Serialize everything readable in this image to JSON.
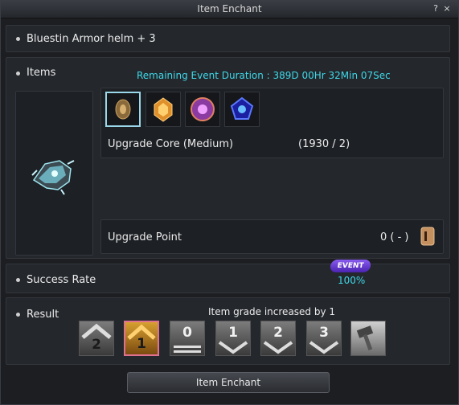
{
  "window": {
    "title": "Item Enchant",
    "help_label": "?",
    "close_label": "×"
  },
  "item": {
    "name": "Bluestin Armor helm + 3"
  },
  "items_section": {
    "label": "Items",
    "event_duration": "Remaining Event Duration : 389D 00Hr 32Min 07Sec",
    "materials": [
      {
        "icon": "brown-core-icon"
      },
      {
        "icon": "orange-crystal-icon"
      },
      {
        "icon": "purple-orb-icon"
      },
      {
        "icon": "blue-pentagon-icon"
      }
    ],
    "upgrade_core_label": "Upgrade Core (Medium)",
    "upgrade_core_count": "(1930 / 2)",
    "upgrade_point_label": "Upgrade Point",
    "upgrade_point_value": "0 ( - )"
  },
  "success": {
    "label": "Success Rate",
    "event_badge": "EVENT",
    "rate": "100%"
  },
  "result": {
    "label": "Result",
    "message": "Item grade increased by 1",
    "grades": [
      "2",
      "1",
      "0",
      "1",
      "2",
      "3"
    ]
  },
  "actions": {
    "enchant_label": "Item Enchant"
  },
  "colors": {
    "accent": "#3fd8e8",
    "selected": "#9ad7e8",
    "event": "#6a3fd0"
  }
}
